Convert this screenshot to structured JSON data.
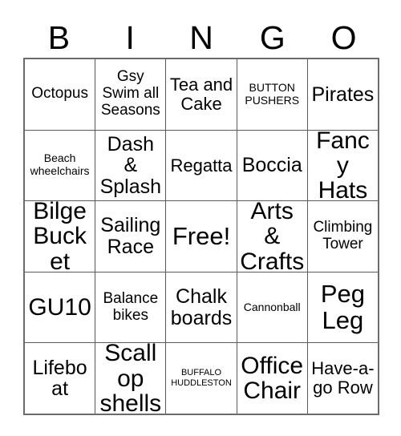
{
  "card": {
    "header_letters": [
      "B",
      "I",
      "N",
      "G",
      "O"
    ],
    "rows": [
      [
        {
          "text": "Octopus",
          "size": "md"
        },
        {
          "text": "Gsy Swim all Seasons",
          "size": "md"
        },
        {
          "text": "Tea and Cake",
          "size": "lg"
        },
        {
          "text": "BUTTON PUSHERS",
          "size": "sm"
        },
        {
          "text": "Pirates",
          "size": "xl"
        }
      ],
      [
        {
          "text": "Beach wheelchairs",
          "size": "sm"
        },
        {
          "text": "Dash & Splash",
          "size": "xl"
        },
        {
          "text": "Regatta",
          "size": "lg"
        },
        {
          "text": "Boccia",
          "size": "xl"
        },
        {
          "text": "Fancy Hats",
          "size": "xxl"
        }
      ],
      [
        {
          "text": "Bilge Bucket",
          "size": "xxl"
        },
        {
          "text": "Sailing Race",
          "size": "xl"
        },
        {
          "text": "Free!",
          "size": "free"
        },
        {
          "text": "Arts & Crafts",
          "size": "xxl"
        },
        {
          "text": "Climbing Tower",
          "size": "md"
        }
      ],
      [
        {
          "text": "GU10",
          "size": "xxl"
        },
        {
          "text": "Balance bikes",
          "size": "md"
        },
        {
          "text": "Chalk boards",
          "size": "xl"
        },
        {
          "text": "Cannonball",
          "size": "sm"
        },
        {
          "text": "Peg Leg",
          "size": "free"
        }
      ],
      [
        {
          "text": "Lifeboat",
          "size": "xl"
        },
        {
          "text": "Scallop shells",
          "size": "xxl"
        },
        {
          "text": "BUFFALO HUDDLESTON",
          "size": "xs"
        },
        {
          "text": "Office Chair",
          "size": "xxl"
        },
        {
          "text": "Have-a-go Row",
          "size": "lg"
        }
      ]
    ],
    "colors": {
      "background": "#ffffff",
      "text": "#000000",
      "grid_line": "#5a5a5a",
      "grid_border": "#6b6b6b"
    }
  }
}
